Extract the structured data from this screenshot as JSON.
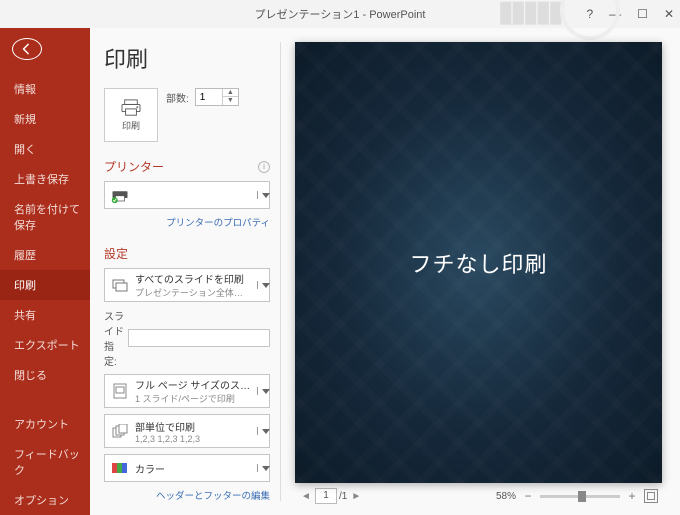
{
  "titlebar": {
    "title": "プレゼンテーション1 - PowerPoint"
  },
  "sidebar": {
    "items": [
      {
        "label": "情報"
      },
      {
        "label": "新規"
      },
      {
        "label": "開く"
      },
      {
        "label": "上書き保存"
      },
      {
        "label": "名前を付けて保存"
      },
      {
        "label": "履歴"
      },
      {
        "label": "印刷",
        "selected": true
      },
      {
        "label": "共有"
      },
      {
        "label": "エクスポート"
      },
      {
        "label": "閉じる"
      }
    ],
    "bottom": [
      {
        "label": "アカウント"
      },
      {
        "label": "フィードバック"
      },
      {
        "label": "オプション"
      }
    ]
  },
  "print": {
    "heading": "印刷",
    "button_label": "印刷",
    "copies_label": "部数:",
    "copies_value": "1",
    "printer_heading": "プリンター",
    "printer_selected": "",
    "printer_props_link": "プリンターのプロパティ",
    "settings_heading": "設定",
    "scope": {
      "line1": "すべてのスライドを印刷",
      "line2": "プレゼンテーション全体を印刷"
    },
    "slide_spec_label": "スライド指定:",
    "slide_spec_value": "",
    "layout": {
      "line1": "フル ページ サイズのスライド",
      "line2": "1 スライド/ページで印刷"
    },
    "collate": {
      "line1": "部単位で印刷",
      "line2": "1,2,3   1,2,3   1,2,3"
    },
    "color": {
      "line1": "カラー"
    },
    "header_footer_link": "ヘッダーとフッターの編集"
  },
  "preview": {
    "slide_text": "フチなし印刷",
    "page_current": "1",
    "page_total": "/1",
    "zoom_label": "58%"
  }
}
